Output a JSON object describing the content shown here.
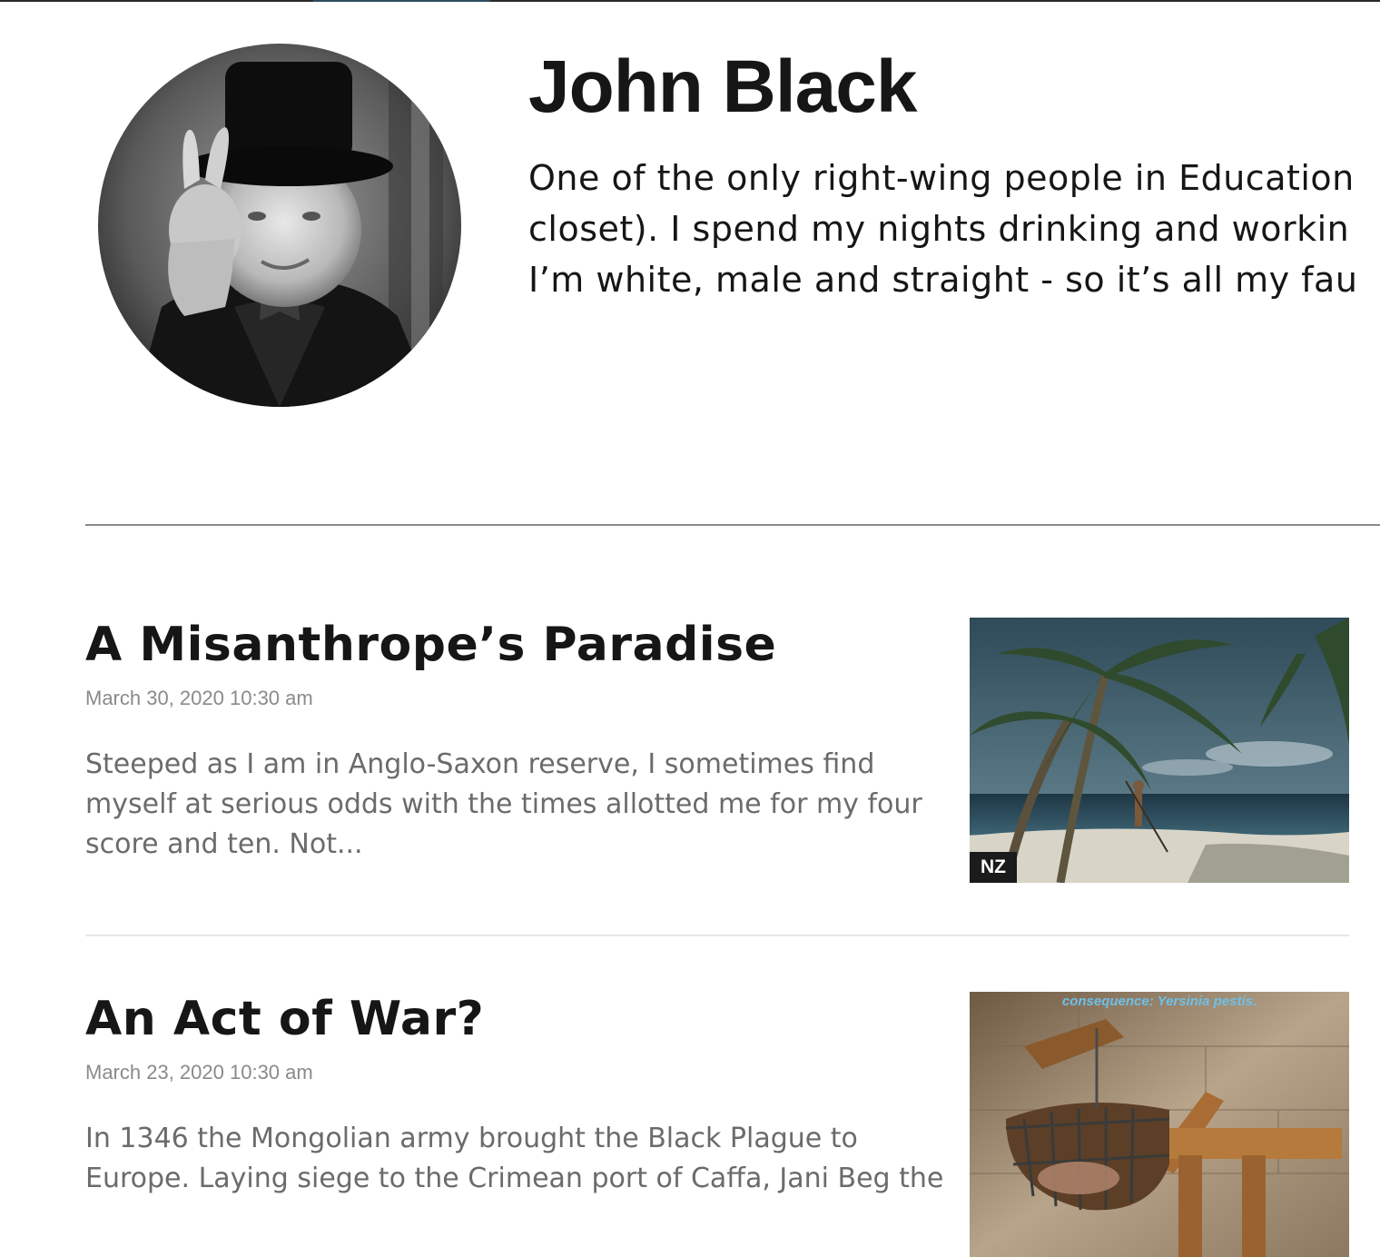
{
  "author": {
    "name": "John Black",
    "bio_lines": [
      "One of the only right-wing people in Education",
      "closet). I spend my nights drinking and workin",
      "I’m white, male and straight - so it’s all my fau"
    ]
  },
  "articles": [
    {
      "title": "A Misanthrope’s Paradise",
      "date": "March 30, 2020 10:30 am",
      "excerpt_lines": [
        "Steeped as I am in Anglo-Saxon reserve, I sometimes find",
        "myself at serious odds with the times allotted me for my four",
        "score and ten. Not..."
      ],
      "tag": "NZ"
    },
    {
      "title": "An Act of War?",
      "date": "March 23, 2020 10:30 am",
      "excerpt_lines": [
        "In 1346 the Mongolian army brought the Black Plague to",
        "Europe.  Laying siege to the Crimean port of Caffa, Jani Beg the"
      ],
      "image_caption": "consequence: Yersinia pestis."
    }
  ],
  "colors": {
    "text_dark": "#161616",
    "meta_gray": "#8a8a8a",
    "excerpt_gray": "#6b6b6b",
    "tag_bg": "#1b1b1b"
  }
}
